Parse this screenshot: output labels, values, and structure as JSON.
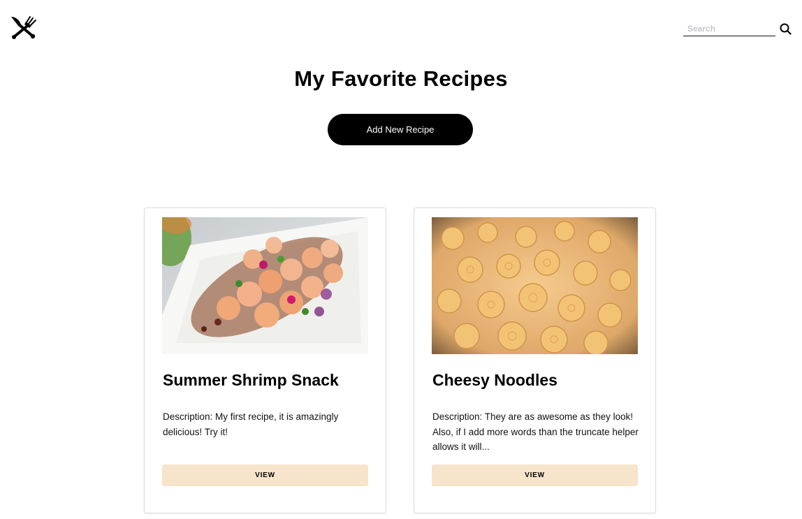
{
  "header": {
    "logo_icon": "fork-knife-icon",
    "search": {
      "placeholder": "Search",
      "value": "",
      "icon": "search-icon"
    }
  },
  "main": {
    "title": "My Favorite Recipes",
    "add_button_label": "Add New Recipe"
  },
  "recipes": [
    {
      "title": "Summer Shrimp Snack",
      "description": "Description: My first recipe, it is amazingly delicious! Try it!",
      "view_label": "VIEW",
      "image": "shrimp-salad-photo"
    },
    {
      "title": "Cheesy Noodles",
      "description": "Description: They are as awesome as they look! Also, if I add more words than the truncate helper allows it will...",
      "view_label": "VIEW",
      "image": "cheesy-pasta-photo"
    }
  ],
  "colors": {
    "accent": "#000000",
    "view_button_bg": "#f6e4cb",
    "card_border": "#dcdcdc"
  }
}
